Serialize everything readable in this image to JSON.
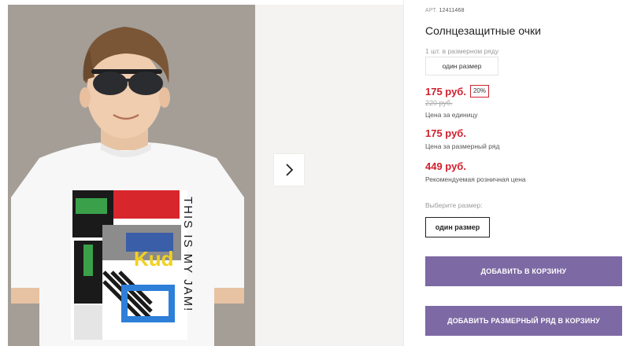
{
  "gallery": {
    "main_image_alt": "",
    "shirt_text_vertical": "THIS IS MY JAM!",
    "shirt_text_logo": "Kud",
    "next_label": "›"
  },
  "product": {
    "sku_label": "АРТ.",
    "sku_value": "12411468",
    "title": "Солнцезащитные очки",
    "pack_note": "1 шт. в размерном ряду",
    "size_chip": "один размер"
  },
  "prices": {
    "unit_price": "175 руб.",
    "discount_badge": "20%",
    "old_price": "220 руб.",
    "unit_note": "Цена за единицу",
    "set_price": "175 руб.",
    "set_note": "Цена за размерный ряд",
    "retail_price": "449 руб.",
    "retail_note": "Рекомендуемая розничная цена"
  },
  "size_select": {
    "label": "Выберите размер:",
    "option": "один размер"
  },
  "actions": {
    "add_to_cart": "ДОБАВИТЬ В КОРЗИНУ",
    "add_set_to_cart": "ДОБАВИТЬ РАЗМЕРНЫЙ РЯД В КОРЗИНУ"
  },
  "colors": {
    "accent": "#7d69a3",
    "price_red": "#d0202e"
  }
}
